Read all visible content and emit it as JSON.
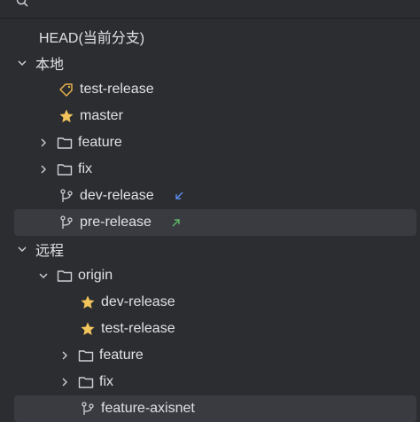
{
  "tree": {
    "head": "HEAD(当前分支)",
    "local": {
      "label": "本地",
      "items": [
        {
          "label": "test-release",
          "icon": "tag-icon"
        },
        {
          "label": "master",
          "icon": "star-icon"
        },
        {
          "label": "feature",
          "icon": "folder-icon"
        },
        {
          "label": "fix",
          "icon": "folder-icon"
        },
        {
          "label": "dev-release",
          "icon": "branch-icon",
          "indicator": "incoming-arrow-icon"
        },
        {
          "label": "pre-release",
          "icon": "branch-icon",
          "indicator": "outgoing-arrow-icon"
        }
      ]
    },
    "remote": {
      "label": "远程",
      "origin": {
        "label": "origin",
        "items": [
          {
            "label": "dev-release",
            "icon": "star-icon"
          },
          {
            "label": "test-release",
            "icon": "star-icon"
          },
          {
            "label": "feature",
            "icon": "folder-icon"
          },
          {
            "label": "fix",
            "icon": "folder-icon"
          },
          {
            "label": "feature-axisnet",
            "icon": "branch-icon"
          }
        ]
      }
    }
  },
  "colors": {
    "background": "#2b2d30",
    "selected_row": "#393b40",
    "text": "#dfe1e5",
    "star": "#f2c55c",
    "tag": "#e8b04a",
    "incoming_arrow": "#5a8dee",
    "outgoing_arrow": "#5fb865"
  }
}
